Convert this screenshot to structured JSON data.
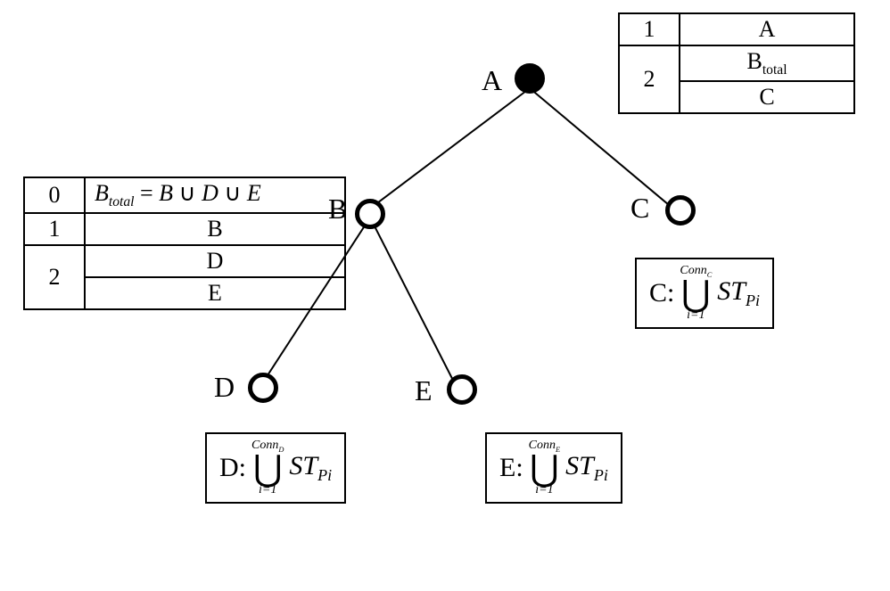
{
  "nodes": {
    "A": {
      "label": "A",
      "filled": true
    },
    "B": {
      "label": "B",
      "filled": false
    },
    "C": {
      "label": "C",
      "filled": false
    },
    "D": {
      "label": "D",
      "filled": false
    },
    "E": {
      "label": "E",
      "filled": false
    }
  },
  "tables": {
    "topRight": {
      "rows": [
        {
          "left": "1",
          "right": "A"
        },
        {
          "left": "2",
          "rightA": "B",
          "rightA_sub": "total",
          "rightB": "C"
        }
      ]
    },
    "left": {
      "rows": [
        {
          "left": "0",
          "rightEq": {
            "lhs": "B",
            "lhs_sub": "total",
            "terms": [
              "B",
              "D",
              "E"
            ]
          }
        },
        {
          "left": "1",
          "right": "B"
        },
        {
          "left": "2",
          "rightA": "D",
          "rightB": "E"
        }
      ]
    }
  },
  "formulas": {
    "C": {
      "label": "C",
      "conn_sub": "C",
      "term": "ST",
      "term_sub": "Pi",
      "lower": "i=1"
    },
    "D": {
      "label": "D",
      "conn_sub": "D",
      "term": "ST",
      "term_sub": "Pi",
      "lower": "i=1"
    },
    "E": {
      "label": "E",
      "conn_sub": "E",
      "term": "ST",
      "term_sub": "Pi",
      "lower": "i=1"
    }
  }
}
